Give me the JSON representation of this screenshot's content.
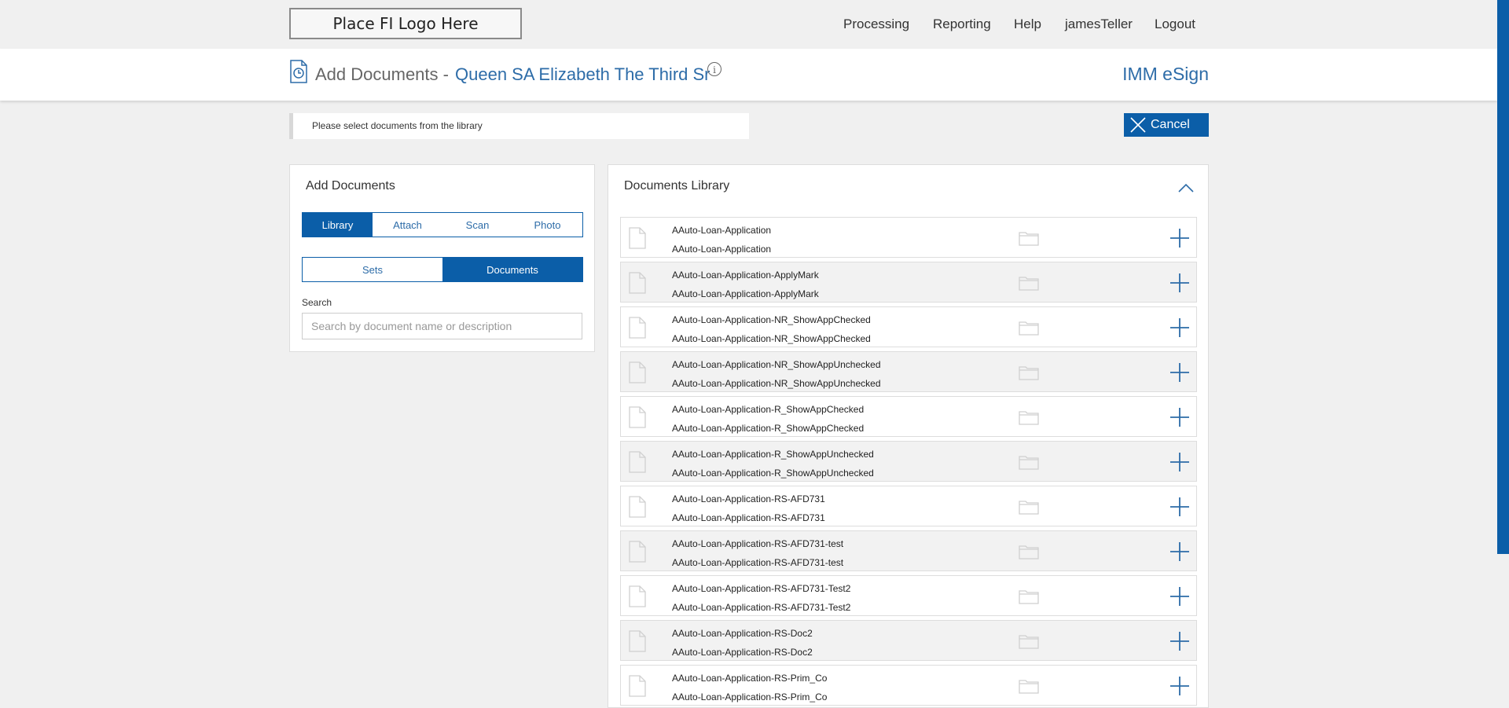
{
  "header": {
    "logo_text": "Place FI Logo Here",
    "nav": [
      "Processing",
      "Reporting",
      "Help",
      "jamesTeller",
      "Logout"
    ]
  },
  "title": {
    "prefix": "Add Documents -",
    "customer": "Queen SA Elizabeth The Third Sr",
    "info_icon": "info-icon",
    "brand": "IMM eSign"
  },
  "notice": "Please select documents from the library",
  "cancel_label": "Cancel",
  "add_panel": {
    "title": "Add Documents",
    "source_tabs": [
      {
        "label": "Library",
        "active": true
      },
      {
        "label": "Attach",
        "active": false
      },
      {
        "label": "Scan",
        "active": false
      },
      {
        "label": "Photo",
        "active": false
      }
    ],
    "type_tabs": [
      {
        "label": "Sets",
        "active": false
      },
      {
        "label": "Documents",
        "active": true
      }
    ],
    "search_label": "Search",
    "search_placeholder": "Search by document name or description",
    "search_value": ""
  },
  "library": {
    "title": "Documents Library",
    "documents": [
      {
        "name": "AAuto-Loan-Application",
        "description": "AAuto-Loan-Application"
      },
      {
        "name": "AAuto-Loan-Application-ApplyMark",
        "description": "AAuto-Loan-Application-ApplyMark"
      },
      {
        "name": "AAuto-Loan-Application-NR_ShowAppChecked",
        "description": "AAuto-Loan-Application-NR_ShowAppChecked"
      },
      {
        "name": "AAuto-Loan-Application-NR_ShowAppUnchecked",
        "description": "AAuto-Loan-Application-NR_ShowAppUnchecked"
      },
      {
        "name": "AAuto-Loan-Application-R_ShowAppChecked",
        "description": "AAuto-Loan-Application-R_ShowAppChecked"
      },
      {
        "name": "AAuto-Loan-Application-R_ShowAppUnchecked",
        "description": "AAuto-Loan-Application-R_ShowAppUnchecked"
      },
      {
        "name": "AAuto-Loan-Application-RS-AFD731",
        "description": "AAuto-Loan-Application-RS-AFD731"
      },
      {
        "name": "AAuto-Loan-Application-RS-AFD731-test",
        "description": "AAuto-Loan-Application-RS-AFD731-test"
      },
      {
        "name": "AAuto-Loan-Application-RS-AFD731-Test2",
        "description": "AAuto-Loan-Application-RS-AFD731-Test2"
      },
      {
        "name": "AAuto-Loan-Application-RS-Doc2",
        "description": "AAuto-Loan-Application-RS-Doc2"
      },
      {
        "name": "AAuto-Loan-Application-RS-Prim_Co",
        "description": "AAuto-Loan-Application-RS-Prim_Co"
      }
    ]
  },
  "colors": {
    "accent": "#0b5ea8",
    "link": "#2d6ca8"
  }
}
